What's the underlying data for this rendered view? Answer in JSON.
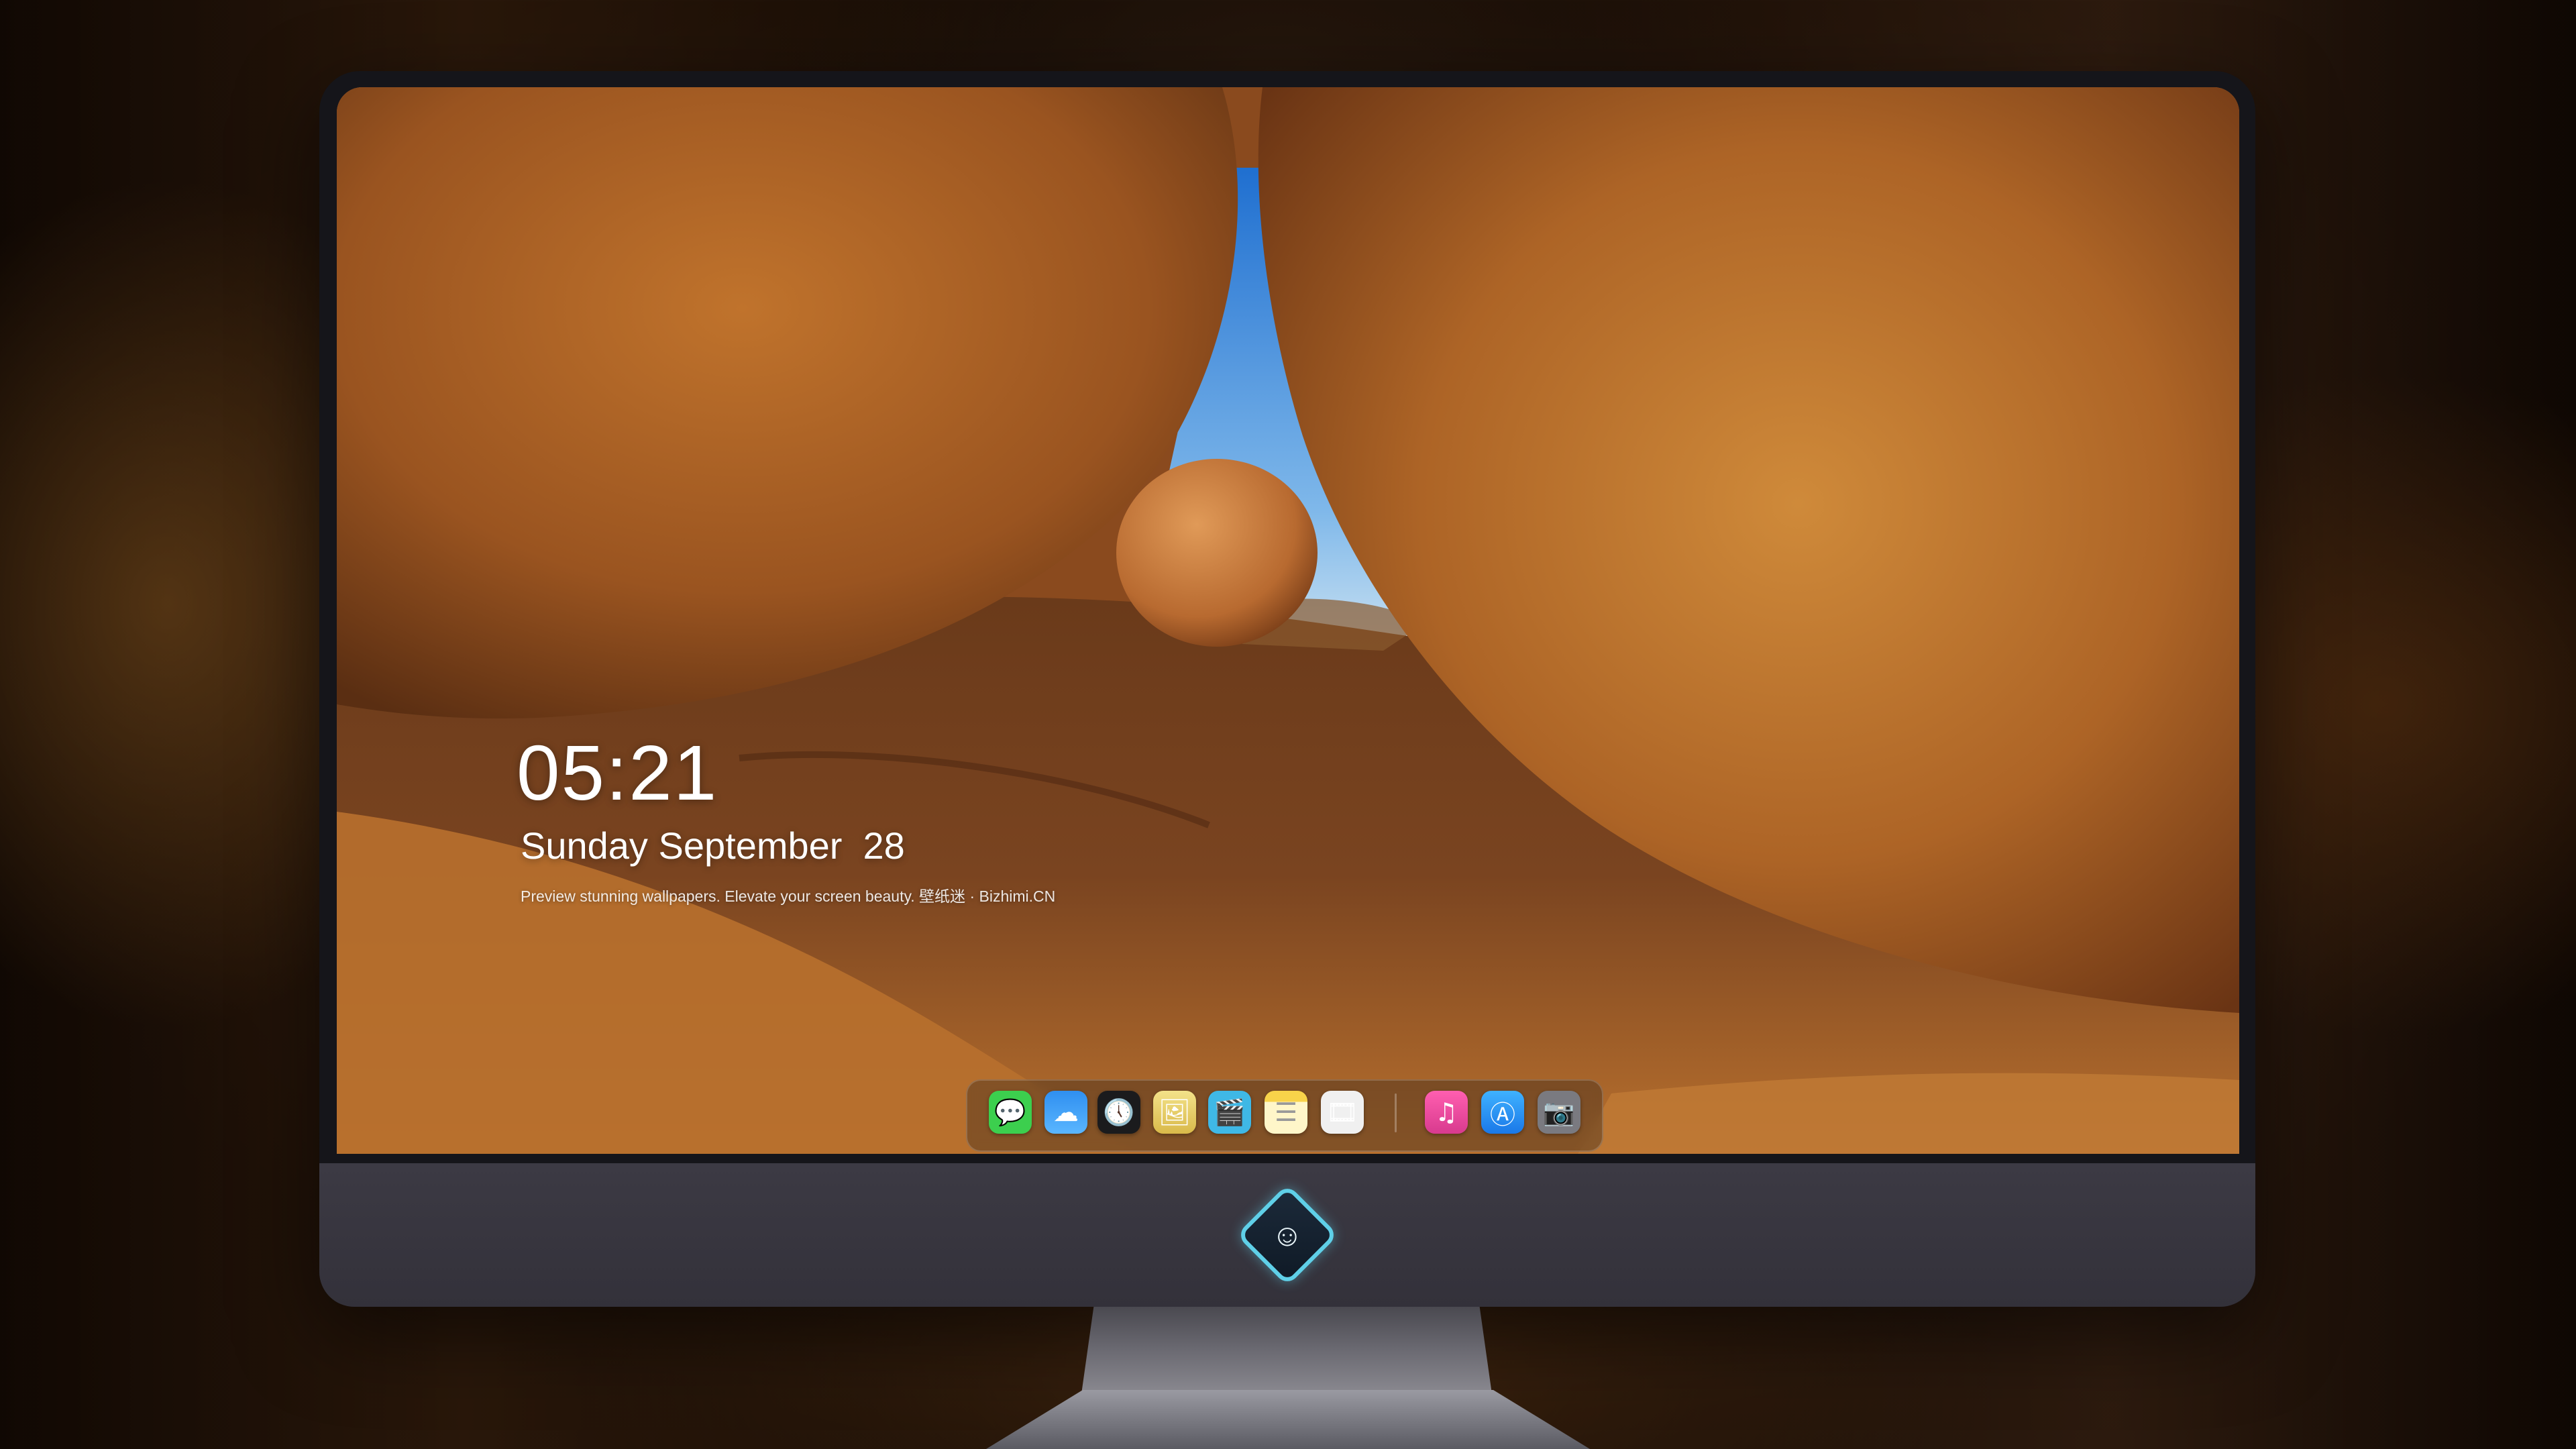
{
  "lock_screen": {
    "time": "05:21",
    "date": "Sunday September  28",
    "tagline": "Preview stunning wallpapers. Elevate your screen beauty. 壁纸迷 · Bizhimi.CN"
  },
  "dock": {
    "apps": [
      {
        "name": "Messages",
        "icon": "messages-icon",
        "color": "#3ccf4e"
      },
      {
        "name": "Weather",
        "icon": "weather-icon",
        "color": "#2f8ff0"
      },
      {
        "name": "Clock",
        "icon": "clock-icon",
        "color": "#ffffff"
      },
      {
        "name": "Preview",
        "icon": "preview-icon",
        "color": "#e9d36b"
      },
      {
        "name": "Clips",
        "icon": "clips-icon",
        "color": "#3fb8e6"
      },
      {
        "name": "Notes",
        "icon": "notes-icon",
        "color": "#fff6c9"
      },
      {
        "name": "Photo Booth",
        "icon": "photo-booth-icon",
        "color": "#f0f0f0"
      },
      {
        "name": "Music",
        "icon": "music-icon",
        "color": "#f04aa0"
      },
      {
        "name": "App Store",
        "icon": "app-store-icon",
        "color": "#1f8ff5"
      },
      {
        "name": "Camera",
        "icon": "camera-icon",
        "color": "#7a7a80"
      }
    ]
  },
  "hardware": {
    "chin_logo": "monitor-logo-icon",
    "accent": "#5fd0e8"
  }
}
